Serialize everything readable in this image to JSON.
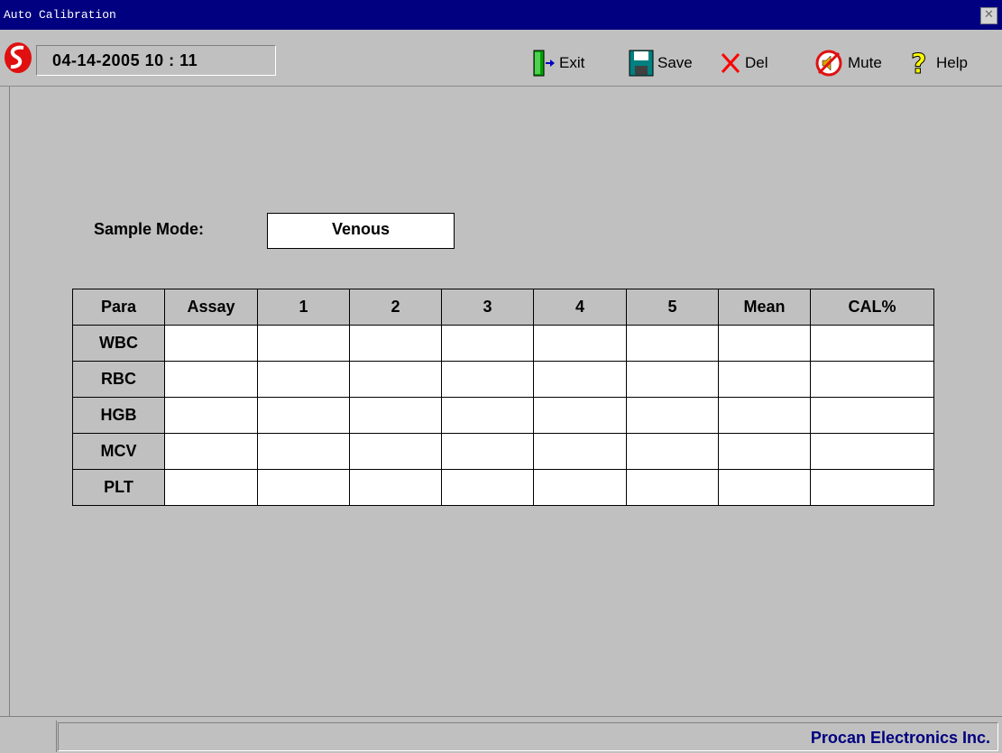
{
  "window": {
    "title": "Auto Calibration"
  },
  "header": {
    "datetime": "04-14-2005  10 : 11"
  },
  "toolbar": {
    "exit_label": "Exit",
    "save_label": "Save",
    "del_label": "Del",
    "mute_label": "Mute",
    "help_label": "Help"
  },
  "sample_mode": {
    "label": "Sample Mode:",
    "value": "Venous"
  },
  "table": {
    "columns": [
      "Para",
      "Assay",
      "1",
      "2",
      "3",
      "4",
      "5",
      "Mean",
      "CAL%"
    ],
    "rows": [
      "WBC",
      "RBC",
      "HGB",
      "MCV",
      "PLT"
    ]
  },
  "status": {
    "company": "Procan Electronics Inc."
  },
  "icons": [
    "close-icon",
    "logo-icon",
    "exit-door-icon",
    "save-floppy-icon",
    "delete-x-icon",
    "mute-speaker-icon",
    "help-question-icon"
  ],
  "colors": {
    "titlebar": "#000080",
    "background": "#c0c0c0",
    "company_text": "#000080",
    "delete_icon": "#ff0000",
    "help_icon": "#ffff00"
  }
}
